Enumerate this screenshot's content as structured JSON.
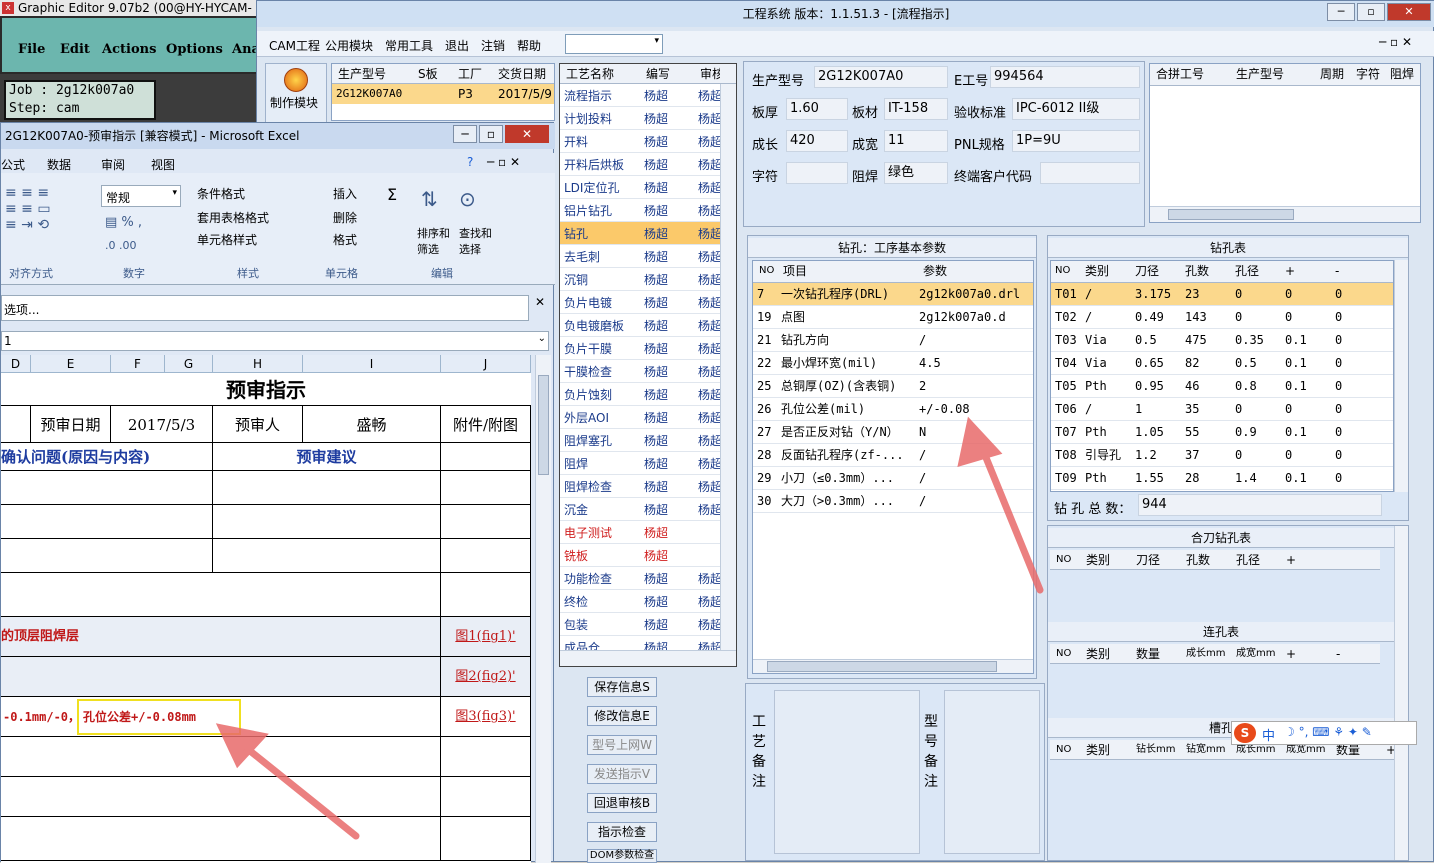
{
  "genesis": {
    "title": "Graphic Editor 9.07b2 (00@HY-HYCAM-",
    "menu": [
      "File",
      "Edit",
      "Actions",
      "Options",
      "Ana"
    ],
    "job_line": "Job : 2g12k007a0",
    "step_line": "Step: cam"
  },
  "cam": {
    "title": "工程系统  版本：1.1.51.3 - [流程指示]",
    "menu": [
      "CAM工程",
      "公用模块",
      "常用工具",
      "退出",
      "注销",
      "帮助"
    ],
    "toolbar_label": "制作模块",
    "top_grid": {
      "headers": [
        "生产型号",
        "S板",
        "工厂",
        "交货日期"
      ],
      "row": [
        "2G12K007A0",
        "",
        "P3",
        "2017/5/9"
      ]
    },
    "process": {
      "headers": [
        "工艺名称",
        "编写",
        "审核"
      ],
      "rows": [
        {
          "name": "流程指示",
          "writer": "杨超",
          "aud": "杨超"
        },
        {
          "name": "计划投料",
          "writer": "杨超",
          "aud": "杨超"
        },
        {
          "name": "开料",
          "writer": "杨超",
          "aud": "杨超"
        },
        {
          "name": "开料后烘板",
          "writer": "杨超",
          "aud": "杨超"
        },
        {
          "name": "LDI定位孔",
          "writer": "杨超",
          "aud": "杨超"
        },
        {
          "name": "铝片钻孔",
          "writer": "杨超",
          "aud": "杨超"
        },
        {
          "name": "钻孔",
          "writer": "杨超",
          "aud": "杨超",
          "sel": true
        },
        {
          "name": "去毛刺",
          "writer": "杨超",
          "aud": "杨超"
        },
        {
          "name": "沉铜",
          "writer": "杨超",
          "aud": "杨超"
        },
        {
          "name": "负片电镀",
          "writer": "杨超",
          "aud": "杨超"
        },
        {
          "name": "负电镀磨板",
          "writer": "杨超",
          "aud": "杨超"
        },
        {
          "name": "负片干膜",
          "writer": "杨超",
          "aud": "杨超"
        },
        {
          "name": "干膜检查",
          "writer": "杨超",
          "aud": "杨超"
        },
        {
          "name": "负片蚀刻",
          "writer": "杨超",
          "aud": "杨超"
        },
        {
          "name": "外层AOI",
          "writer": "杨超",
          "aud": "杨超"
        },
        {
          "name": "阻焊塞孔",
          "writer": "杨超",
          "aud": "杨超"
        },
        {
          "name": "阻焊",
          "writer": "杨超",
          "aud": "杨超"
        },
        {
          "name": "阻焊检查",
          "writer": "杨超",
          "aud": "杨超"
        },
        {
          "name": "沉金",
          "writer": "杨超",
          "aud": "杨超"
        },
        {
          "name": "电子测试",
          "writer": "杨超",
          "aud": "",
          "red": true
        },
        {
          "name": "铣板",
          "writer": "杨超",
          "aud": "",
          "red": true
        },
        {
          "name": "功能检查",
          "writer": "杨超",
          "aud": "杨超"
        },
        {
          "name": "终检",
          "writer": "杨超",
          "aud": "杨超"
        },
        {
          "name": "包装",
          "writer": "杨超",
          "aud": "杨超"
        },
        {
          "name": "成品仓",
          "writer": "杨超",
          "aud": "杨超"
        }
      ]
    },
    "buttons": [
      "保存信息S",
      "修改信息E",
      "型号上网W",
      "发送指示V",
      "回退审核B",
      "指示检查",
      "DOM参数检查"
    ],
    "info": {
      "prod_model_label": "生产型号",
      "prod_model": "2G12K007A0",
      "e_label": "E工号",
      "e_value": "994564",
      "thick_label": "板厚",
      "thick": "1.60",
      "mat_label": "板材",
      "mat": "IT-158",
      "std_label": "验收标准",
      "std": "IPC-6012 II级",
      "len_label": "成长",
      "len": "420",
      "wid_label": "成宽",
      "wid": "11",
      "pnl_label": "PNL规格",
      "pnl": "1P=9U",
      "char_label": "字符",
      "char": "",
      "mask_label": "阻焊",
      "mask": "绿色",
      "cust_label": "终端客户代码",
      "cust": ""
    },
    "merge_headers": [
      "合拼工号",
      "生产型号",
      "周期",
      "字符",
      "阻焊"
    ],
    "drill_params": {
      "title": "钻孔：工序基本参数",
      "headers": [
        "NO",
        "项目",
        "参数"
      ],
      "rows": [
        {
          "no": "7",
          "item": "一次钻孔程序(DRL)",
          "val": "2g12k007a0.drl"
        },
        {
          "no": "19",
          "item": "点图",
          "val": "2g12k007a0.d"
        },
        {
          "no": "21",
          "item": "钻孔方向",
          "val": "/"
        },
        {
          "no": "22",
          "item": "最小焊环宽(mil)",
          "val": "4.5"
        },
        {
          "no": "25",
          "item": "总铜厚(OZ)(含表铜)",
          "val": "2"
        },
        {
          "no": "26",
          "item": "孔位公差(mil)",
          "val": "+/-0.08"
        },
        {
          "no": "27",
          "item": "是否正反对钻（Y/N）",
          "val": "N"
        },
        {
          "no": "28",
          "item": "反面钻孔程序(zf-...",
          "val": "/"
        },
        {
          "no": "29",
          "item": "小刀（≤0.3mm）...",
          "val": "/"
        },
        {
          "no": "30",
          "item": "大刀（>0.3mm）...",
          "val": "/"
        }
      ]
    },
    "drill_table": {
      "title": "钻孔表",
      "headers": [
        "NO",
        "类别",
        "刀径",
        "孔数",
        "孔径",
        "+",
        "-"
      ],
      "rows": [
        [
          "T01",
          "/",
          "3.175",
          "23",
          "0",
          "0",
          "0"
        ],
        [
          "T02",
          "/",
          "0.49",
          "143",
          "0",
          "0",
          "0"
        ],
        [
          "T03",
          "Via",
          "0.5",
          "475",
          "0.35",
          "0.1",
          "0"
        ],
        [
          "T04",
          "Via",
          "0.65",
          "82",
          "0.5",
          "0.1",
          "0"
        ],
        [
          "T05",
          "Pth",
          "0.95",
          "46",
          "0.8",
          "0.1",
          "0"
        ],
        [
          "T06",
          "/",
          "1",
          "35",
          "0",
          "0",
          "0"
        ],
        [
          "T07",
          "Pth",
          "1.05",
          "55",
          "0.9",
          "0.1",
          "0"
        ],
        [
          "T08",
          "引导孔",
          "1.2",
          "37",
          "0",
          "0",
          "0"
        ],
        [
          "T09",
          "Pth",
          "1.55",
          "28",
          "1.4",
          "0.1",
          "0"
        ]
      ],
      "total_label": "钻 孔 总 数：",
      "total": "944"
    },
    "knife_table": {
      "title": "合刀钻孔表",
      "headers": [
        "NO",
        "类别",
        "刀径",
        "孔数",
        "孔径",
        "+"
      ]
    },
    "link_table": {
      "title": "连孔表",
      "headers": [
        "NO",
        "类别",
        "数量",
        "成长mm",
        "成宽mm",
        "+",
        "-"
      ]
    },
    "slot_table": {
      "title": "槽孔",
      "headers": [
        "NO",
        "类别",
        "钻长mm",
        "钻宽mm",
        "成长mm",
        "成宽mm",
        "数量",
        "+"
      ]
    },
    "remark_labels": {
      "craft": "工艺备注",
      "model": "型号备注"
    },
    "ime": "中"
  },
  "excel": {
    "title": "2G12K007A0-预审指示 [兼容模式] - Microsoft Excel",
    "tabs": [
      "公式",
      "数据",
      "审阅",
      "视图"
    ],
    "number_format": "常规",
    "ribbon_items": [
      "条件格式",
      "套用表格格式",
      "单元格样式",
      "插入",
      "删除",
      "格式",
      "排序和筛选",
      "查找和选择"
    ],
    "groups": [
      "对齐方式",
      "数字",
      "样式",
      "单元格",
      "编辑"
    ],
    "options_bar": "选项...",
    "formula_bar": "1",
    "columns": [
      "D",
      "E",
      "F",
      "G",
      "H",
      "I",
      "J"
    ],
    "sheet": {
      "title": "预审指示",
      "pre_date_label": "预审日期",
      "pre_date": "2017/5/3",
      "reviewer_label": "预审人",
      "reviewer": "盛畅",
      "attach_label": "附件/附图",
      "issue_header": "确认问题(原因与内容)",
      "suggest_header": "预审建议",
      "issue1": "的顶层阻焊层",
      "fig1": "图1(fig1)'",
      "fig2": "图2(fig2)'",
      "issue3a": "-0.1mm/-0，",
      "issue3b": "孔位公差+/-0.08mm",
      "fig3": "图3(fig3)'"
    }
  },
  "colors": {
    "accent_orange": "#fbc96a",
    "link_red": "#d02020",
    "arrow": "#e86a6a",
    "highlight_box": "#f0e020"
  }
}
